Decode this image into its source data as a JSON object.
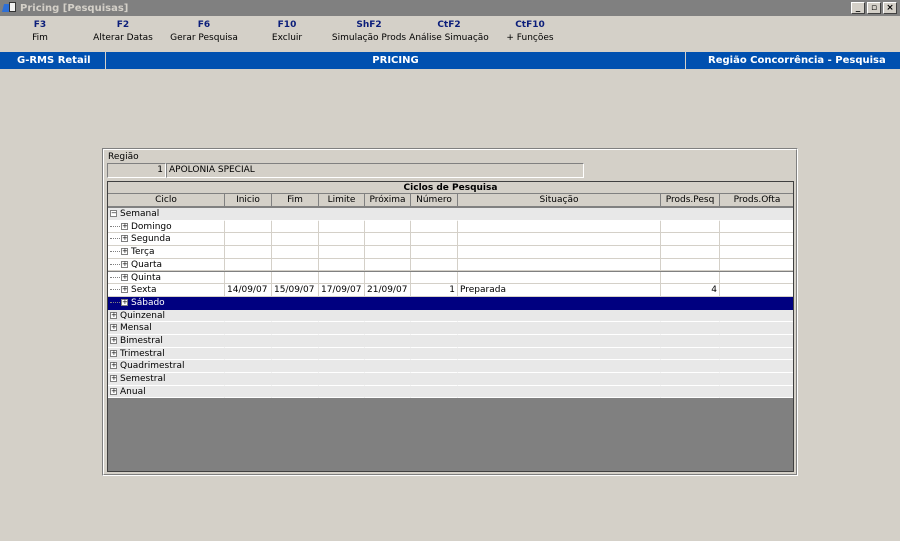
{
  "window": {
    "title": "Pricing [Pesquisas]",
    "min": "_",
    "max": "▫",
    "close": "×"
  },
  "toolbar": [
    {
      "key": "F3",
      "label": "Fim"
    },
    {
      "key": "F2",
      "label": "Alterar Datas"
    },
    {
      "key": "F6",
      "label": "Gerar Pesquisa"
    },
    {
      "key": "F10",
      "label": "Excluir"
    },
    {
      "key": "ShF2",
      "label": "Simulação Prods"
    },
    {
      "key": "CtF2",
      "label": "Análise Simuação"
    },
    {
      "key": "CtF10",
      "label": "+ Funções"
    }
  ],
  "header": {
    "left": "G-RMS Retail",
    "center": "PRICING",
    "right": "Região Concorrência - Pesquisa"
  },
  "regiao": {
    "label": "Região",
    "code": "1",
    "name": "APOLONIA SPECIAL"
  },
  "grid": {
    "title": "Ciclos de Pesquisa",
    "columns": [
      "Ciclo",
      "Inicio",
      "Fim",
      "Limite",
      "Próxima",
      "Número",
      "Situação",
      "Prods.Pesq",
      "Prods.Ofta"
    ],
    "rows": [
      {
        "ciclo": "Semanal",
        "level": 0,
        "expander": "−",
        "inicio": "",
        "fim": "",
        "limite": "",
        "proxima": "",
        "numero": "",
        "situacao": "",
        "pesq": "",
        "ofta": ""
      },
      {
        "ciclo": "Domingo",
        "level": 1,
        "expander": "+",
        "inicio": "",
        "fim": "",
        "limite": "",
        "proxima": "",
        "numero": "",
        "situacao": "",
        "pesq": "",
        "ofta": ""
      },
      {
        "ciclo": "Segunda",
        "level": 1,
        "expander": "+",
        "inicio": "",
        "fim": "",
        "limite": "",
        "proxima": "",
        "numero": "",
        "situacao": "",
        "pesq": "",
        "ofta": ""
      },
      {
        "ciclo": "Terça",
        "level": 1,
        "expander": "+",
        "inicio": "",
        "fim": "",
        "limite": "",
        "proxima": "",
        "numero": "",
        "situacao": "",
        "pesq": "",
        "ofta": ""
      },
      {
        "ciclo": "Quarta",
        "level": 1,
        "expander": "+",
        "inicio": "",
        "fim": "",
        "limite": "",
        "proxima": "",
        "numero": "",
        "situacao": "",
        "pesq": "",
        "ofta": ""
      },
      {
        "ciclo": "Quinta",
        "level": 1,
        "expander": "+",
        "inicio": "",
        "fim": "",
        "limite": "",
        "proxima": "",
        "numero": "",
        "situacao": "",
        "pesq": "",
        "ofta": ""
      },
      {
        "ciclo": "Sexta",
        "level": 1,
        "expander": "+",
        "inicio": "14/09/07",
        "fim": "15/09/07",
        "limite": "17/09/07",
        "proxima": "21/09/07",
        "numero": "1",
        "situacao": "Preparada",
        "pesq": "4",
        "ofta": ""
      },
      {
        "ciclo": "Sábado",
        "level": 1,
        "expander": "+",
        "inicio": "",
        "fim": "",
        "limite": "",
        "proxima": "",
        "numero": "",
        "situacao": "",
        "pesq": "",
        "ofta": "",
        "selected": true
      },
      {
        "ciclo": "Quinzenal",
        "level": 0,
        "expander": "+",
        "inicio": "",
        "fim": "",
        "limite": "",
        "proxima": "",
        "numero": "",
        "situacao": "",
        "pesq": "",
        "ofta": ""
      },
      {
        "ciclo": "Mensal",
        "level": 0,
        "expander": "+",
        "inicio": "",
        "fim": "",
        "limite": "",
        "proxima": "",
        "numero": "",
        "situacao": "",
        "pesq": "",
        "ofta": ""
      },
      {
        "ciclo": "Bimestral",
        "level": 0,
        "expander": "+",
        "inicio": "",
        "fim": "",
        "limite": "",
        "proxima": "",
        "numero": "",
        "situacao": "",
        "pesq": "",
        "ofta": ""
      },
      {
        "ciclo": "Trimestral",
        "level": 0,
        "expander": "+",
        "inicio": "",
        "fim": "",
        "limite": "",
        "proxima": "",
        "numero": "",
        "situacao": "",
        "pesq": "",
        "ofta": ""
      },
      {
        "ciclo": "Quadrimestral",
        "level": 0,
        "expander": "+",
        "inicio": "",
        "fim": "",
        "limite": "",
        "proxima": "",
        "numero": "",
        "situacao": "",
        "pesq": "",
        "ofta": ""
      },
      {
        "ciclo": "Semestral",
        "level": 0,
        "expander": "+",
        "inicio": "",
        "fim": "",
        "limite": "",
        "proxima": "",
        "numero": "",
        "situacao": "",
        "pesq": "",
        "ofta": ""
      },
      {
        "ciclo": "Anual",
        "level": 0,
        "expander": "+",
        "inicio": "",
        "fim": "",
        "limite": "",
        "proxima": "",
        "numero": "",
        "situacao": "",
        "pesq": "",
        "ofta": ""
      }
    ]
  }
}
